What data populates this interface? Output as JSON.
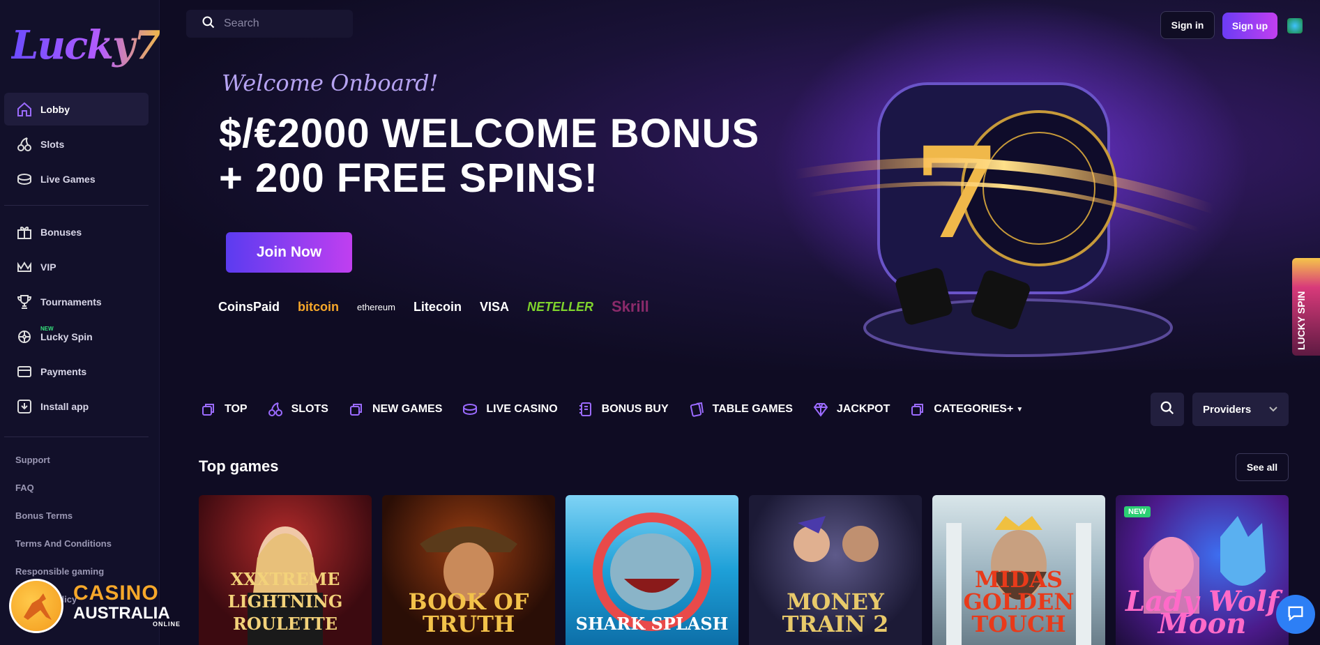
{
  "brand": {
    "logo_text": "Lucky7"
  },
  "search": {
    "placeholder": "Search"
  },
  "header": {
    "signin_label": "Sign in",
    "signup_label": "Sign up"
  },
  "sidebar": {
    "primary": [
      {
        "label": "Lobby",
        "icon": "home-icon",
        "active": true
      },
      {
        "label": "Slots",
        "icon": "cherries-icon"
      },
      {
        "label": "Live Games",
        "icon": "live-games-icon"
      }
    ],
    "secondary": [
      {
        "label": "Bonuses",
        "icon": "gift-icon"
      },
      {
        "label": "VIP",
        "icon": "crown-icon"
      },
      {
        "label": "Tournaments",
        "icon": "trophy-icon"
      },
      {
        "label": "Lucky Spin",
        "icon": "spin-wheel-icon",
        "badge": "NEW"
      },
      {
        "label": "Payments",
        "icon": "card-icon"
      },
      {
        "label": "Install app",
        "icon": "download-icon"
      }
    ],
    "footer_links": [
      "Support",
      "FAQ",
      "Bonus Terms",
      "Terms And Conditions",
      "Responsible gaming",
      "Privacy Policy"
    ]
  },
  "hero": {
    "welcome": "Welcome Onboard!",
    "title_line1": "$/€2000 WELCOME BONUS",
    "title_line2": "+ 200 FREE SPINS!",
    "cta": "Join Now",
    "payments": [
      "CoinsPaid",
      "bitcoin",
      "ethereum",
      "Litecoin",
      "VISA",
      "NETELLER",
      "Skrill"
    ]
  },
  "lucky_spin_tab": "LUCKY SPIN",
  "categories": [
    {
      "label": "TOP",
      "icon": "top-icon"
    },
    {
      "label": "SLOTS",
      "icon": "cherries-icon"
    },
    {
      "label": "NEW GAMES",
      "icon": "new-games-icon"
    },
    {
      "label": "LIVE CASINO",
      "icon": "live-casino-icon"
    },
    {
      "label": "BONUS BUY",
      "icon": "bonus-buy-icon"
    },
    {
      "label": "TABLE GAMES",
      "icon": "cards-icon"
    },
    {
      "label": "JACKPOT",
      "icon": "diamond-icon"
    },
    {
      "label": "CATEGORIES+",
      "icon": "categories-icon"
    }
  ],
  "providers_label": "Providers",
  "top_games": {
    "title": "Top games",
    "see_all": "See all",
    "games": [
      {
        "name": "XXXTREME LIGHTNING ROULETTE"
      },
      {
        "name": "BOOK OF TRUTH"
      },
      {
        "name": "SHARK SPLASH"
      },
      {
        "name": "MONEY TRAIN 2"
      },
      {
        "name": "MIDAS GOLDEN TOUCH"
      },
      {
        "name": "Lady Wolf Moon",
        "badge": "NEW"
      }
    ]
  },
  "watermark": {
    "line1": "CASINO",
    "line2": "AUSTRALIA",
    "line3": "ONLINE"
  },
  "colors": {
    "bg": "#0f0c23",
    "sidebar": "#12102a",
    "accent_from": "#6b3cf4",
    "accent_to": "#c23ff0",
    "neteller": "#7fd32d",
    "new_badge": "#2ccf74"
  }
}
